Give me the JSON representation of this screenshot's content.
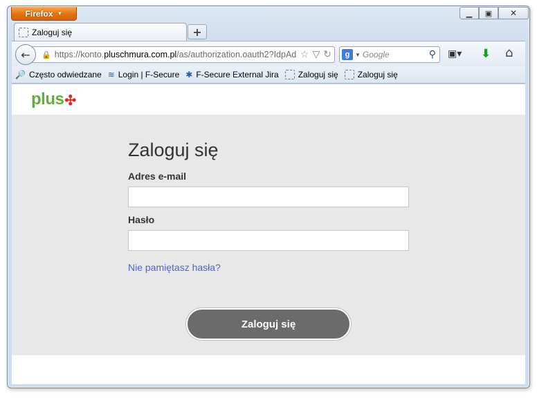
{
  "browser": {
    "app_button": "Firefox",
    "tab": {
      "title": "Zaloguj się"
    },
    "new_tab_symbol": "+",
    "url": {
      "prefix": "https://konto.",
      "host": "pluschmura.com.pl",
      "path": "/as/authorization.oauth2?IdpAd"
    },
    "search": {
      "engine_icon": "g",
      "placeholder": "Google"
    },
    "bookmarks": [
      {
        "label": "Często odwiedzane",
        "icon": "bookmark-folder-icon"
      },
      {
        "label": "Login | F-Secure",
        "icon": "fsecure-icon"
      },
      {
        "label": "F-Secure External Jira",
        "icon": "jira-icon"
      },
      {
        "label": "Zaloguj się",
        "icon": "blank-page-icon"
      },
      {
        "label": "Zaloguj się",
        "icon": "blank-page-icon"
      }
    ]
  },
  "page": {
    "logo_text": "plus",
    "title": "Zaloguj się",
    "email_label": "Adres e-mail",
    "email_value": "",
    "password_label": "Hasło",
    "password_value": "",
    "forgot_link": "Nie pamiętasz hasła?",
    "submit_label": "Zaloguj się"
  },
  "colors": {
    "brand_green": "#5eb135",
    "brand_red": "#e2262b",
    "button_gray": "#6b6b6b",
    "link_blue": "#4d63c9",
    "background_gray": "#e8e8e8"
  }
}
